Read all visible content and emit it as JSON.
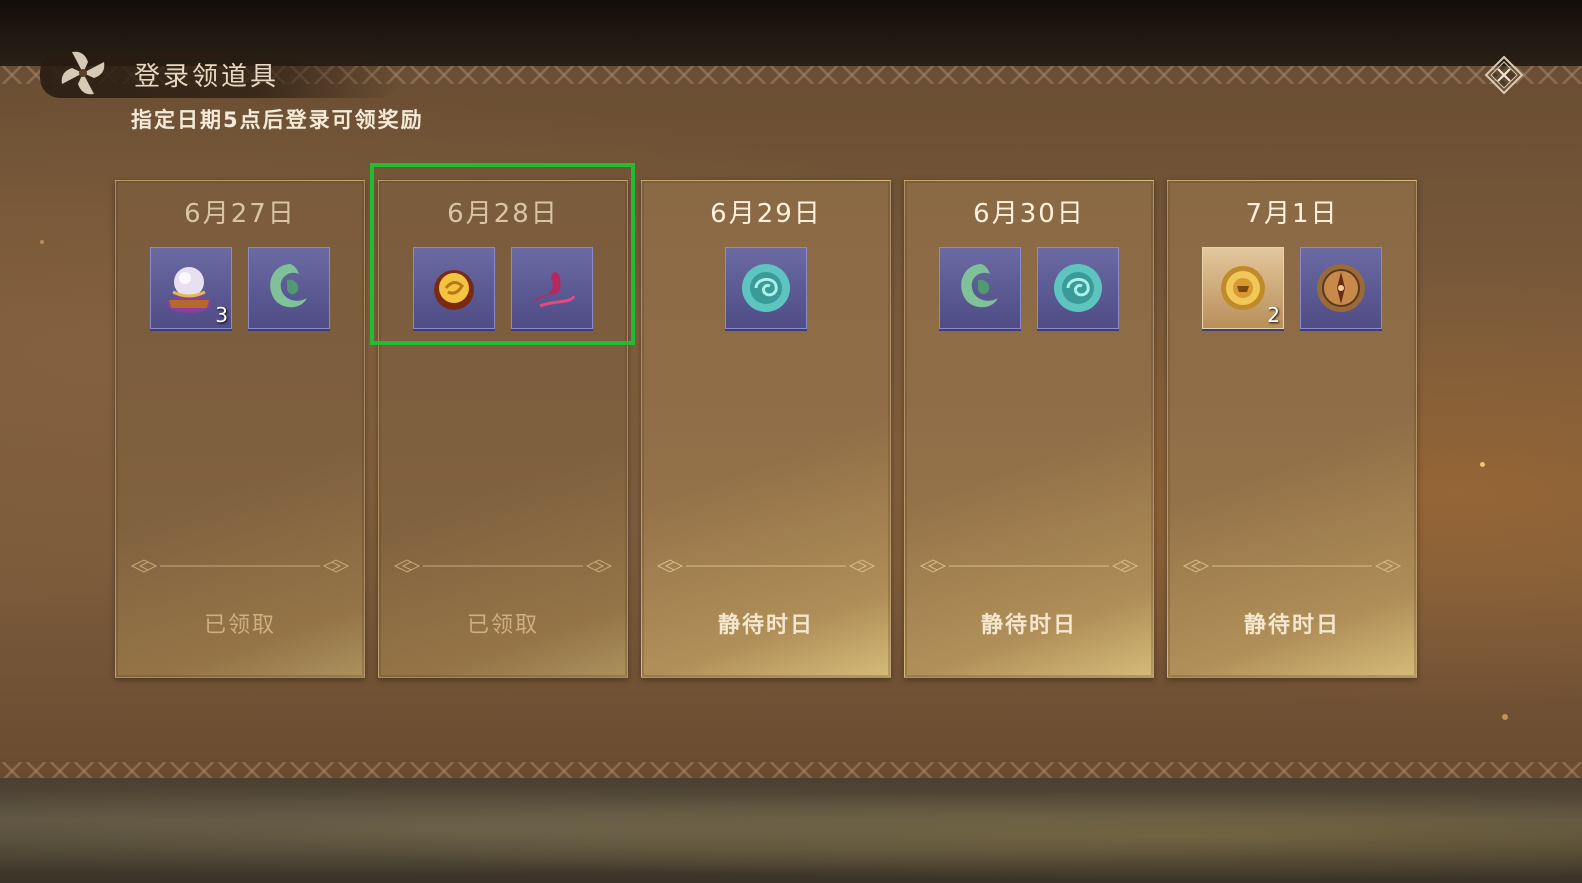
{
  "header": {
    "title": "登录领道具",
    "subtitle": "指定日期5点后登录可领奖励"
  },
  "days": [
    {
      "date": "6月27日",
      "status": "已领取",
      "claimed": true,
      "items": [
        {
          "icon": "crystal-ball-chest-icon",
          "count": "3"
        },
        {
          "icon": "green-jade-icon",
          "count": ""
        }
      ]
    },
    {
      "date": "6月28日",
      "status": "已领取",
      "claimed": true,
      "items": [
        {
          "icon": "gold-orb-icon",
          "count": ""
        },
        {
          "icon": "crimson-ribbon-icon",
          "count": ""
        }
      ]
    },
    {
      "date": "6月29日",
      "status": "静待时日",
      "claimed": false,
      "items": [
        {
          "icon": "cyan-jade-disc-icon",
          "count": ""
        }
      ]
    },
    {
      "date": "6月30日",
      "status": "静待时日",
      "claimed": false,
      "items": [
        {
          "icon": "green-jade-icon",
          "count": ""
        },
        {
          "icon": "cyan-jade-disc-icon",
          "count": ""
        }
      ]
    },
    {
      "date": "7月1日",
      "status": "静待时日",
      "claimed": false,
      "items": [
        {
          "icon": "gold-coin-icon",
          "count": "2"
        },
        {
          "icon": "bronze-compass-icon",
          "count": ""
        }
      ]
    }
  ],
  "colors": {
    "highlight": "#22bb33",
    "item_bg": "#5a5890",
    "panel": "#7a5a3a"
  }
}
